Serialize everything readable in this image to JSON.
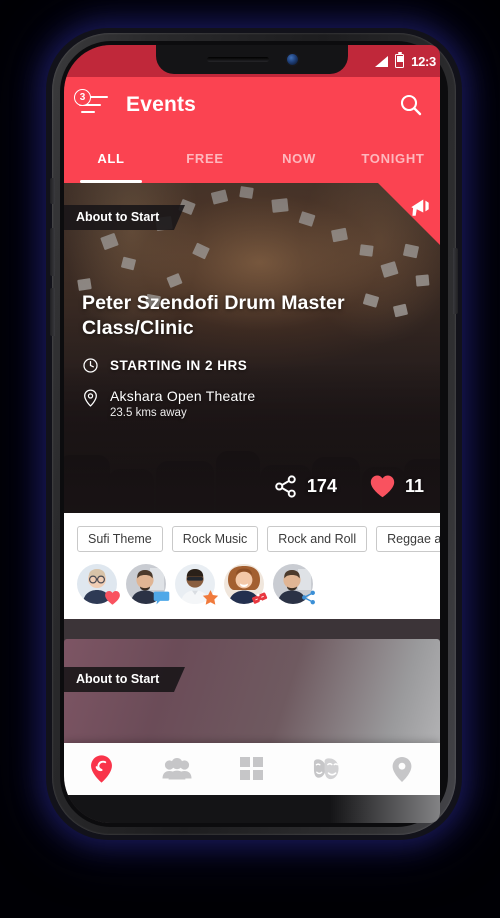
{
  "statusbar": {
    "time": "12:3",
    "signal_icon": "signal-icon",
    "battery_icon": "battery-icon"
  },
  "appbar": {
    "title": "Events",
    "menu_badge": "3",
    "menu_icon": "hamburger-menu-icon",
    "search_icon": "search-icon"
  },
  "tabs": [
    {
      "label": "ALL",
      "active": true
    },
    {
      "label": "FREE",
      "active": false
    },
    {
      "label": "NOW",
      "active": false
    },
    {
      "label": "TONIGHT",
      "active": false
    }
  ],
  "event_card": {
    "ribbon_label": "About to Start",
    "corner_icon": "megaphone-icon",
    "title": "Peter Szendofi Drum Master Class/Clinic",
    "time_icon": "clock-icon",
    "time_label": "STARTING IN 2 HRS",
    "location_icon": "map-pin-icon",
    "venue": "Akshara Open Theatre",
    "distance": "23.5 kms away",
    "share_icon": "share-icon",
    "share_count": "174",
    "like_icon": "heart-icon",
    "like_count": "11",
    "chips": [
      "Sufi Theme",
      "Rock Music",
      "Rock and Roll",
      "Reggae a"
    ],
    "attendees": [
      {
        "badge_icon": "heart-badge-icon",
        "badge_color": "#f9525f"
      },
      {
        "badge_icon": "comment-badge-icon",
        "badge_color": "#4fa8e8"
      },
      {
        "badge_icon": "star-badge-icon",
        "badge_color": "#f07a3c"
      },
      {
        "badge_icon": "ticket-badge-icon",
        "badge_color": "#e8373f"
      },
      {
        "badge_icon": "share-badge-icon",
        "badge_color": "#3b8fd6"
      }
    ]
  },
  "event_card_2": {
    "ribbon_label": "About to Start"
  },
  "bottomnav": [
    {
      "icon": "location-heart-icon",
      "active": true,
      "name": "nav-discover"
    },
    {
      "icon": "people-icon",
      "active": false,
      "name": "nav-people"
    },
    {
      "icon": "grid-icon",
      "active": false,
      "name": "nav-categories"
    },
    {
      "icon": "theater-masks-icon",
      "active": false,
      "name": "nav-shows"
    },
    {
      "icon": "map-pin-icon",
      "active": false,
      "name": "nav-map"
    }
  ],
  "colors": {
    "accent": "#fb4351",
    "statusbar": "#c0283a",
    "nav_active": "#f9344a",
    "nav_inactive": "#c6c6c8",
    "feed_bg": "#3c3438"
  }
}
